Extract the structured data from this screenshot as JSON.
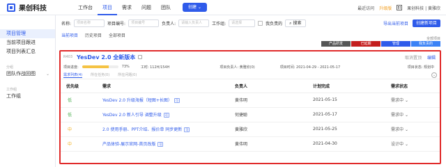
{
  "app": {
    "name": "果创科技"
  },
  "nav": {
    "items": [
      "工作台",
      "项目",
      "需求",
      "问题",
      "团队"
    ],
    "active": 1,
    "create_label": "创建"
  },
  "top_right": {
    "recent": "最近访问",
    "upgrade": "升级版",
    "org": "果创科技 | 黄雅欣"
  },
  "sidebar": {
    "items": [
      {
        "label": "项目管理",
        "active": true
      },
      {
        "label": "当前项目跟进"
      },
      {
        "label": "项目列表汇总"
      }
    ],
    "group2": "分组",
    "team_item": "团队作战回图",
    "group3": "工作组",
    "workgroup": "工作组"
  },
  "filter": {
    "name_label": "名称:",
    "name_ph": "项目名称",
    "no_label": "项目编号:",
    "no_ph": "项目编号",
    "owner_label": "负责人:",
    "owner_ph": "请输入负责人",
    "status_label": "工作组:",
    "status_ph": "请选择",
    "mine_label": "我负责的",
    "search_label": "搜索"
  },
  "main_right": {
    "export_link": "导出当前项目",
    "create_btn": "创建新项目"
  },
  "tabs": {
    "items": [
      "当前项目",
      "历史项目",
      "全部项目"
    ],
    "active": 0
  },
  "all_label": "全部项目",
  "tag_bar": [
    {
      "label": "产品研发",
      "color": "#555555"
    },
    {
      "label": "已延期",
      "color": "#c41e1e"
    },
    {
      "label": "管理",
      "color": "#2f5bea"
    },
    {
      "label": "我负责的",
      "color": "#3b82f6"
    }
  ],
  "project": {
    "id": "R403",
    "title": "YesDev 2.0 全新版本",
    "cancel": "取消置顶",
    "edit": "编辑",
    "progress_label": "项目进度:",
    "progress_percent": 73,
    "progress_text": "73%",
    "hours": "工时: 112H/154H",
    "owner": "项目负责人: 黄雅欣(0)",
    "period": "项目时间: 2021-04-29 - 2021-05-17",
    "state": "项目状态: 规划中",
    "subtabs": [
      "需求列表(4)",
      "所在任务(0)",
      "所在问题(0)"
    ],
    "collapse": "⌄"
  },
  "table": {
    "headers": [
      "优先级",
      "需求",
      "负责人",
      "计划完成",
      "需求状态"
    ],
    "rows": [
      {
        "priority": "低",
        "level": "low",
        "req": "YesDev 2.0 升级海报（短图+长图）",
        "tag": "可",
        "owner": "黄伟明",
        "due": "2021-05-15",
        "status": "需求中"
      },
      {
        "priority": "低",
        "level": "low",
        "req": "YesDev 2.0 新人引导 调整升级",
        "tag": "可",
        "owner": "何捷聪",
        "due": "2021-05-17",
        "status": "需求中"
      },
      {
        "priority": "中",
        "level": "mid",
        "req": "2.0 使用手册、PPT介绍、报价单 同步更新",
        "tag": "可",
        "owner": "黄雅欣",
        "due": "2021-05-25",
        "status": "需求中"
      },
      {
        "priority": "中",
        "level": "mid",
        "req": "产品体验-展示官网-首页改版",
        "tag": "可",
        "owner": "黄伟明",
        "due": "2021-04-30",
        "status": "设计中"
      }
    ]
  }
}
